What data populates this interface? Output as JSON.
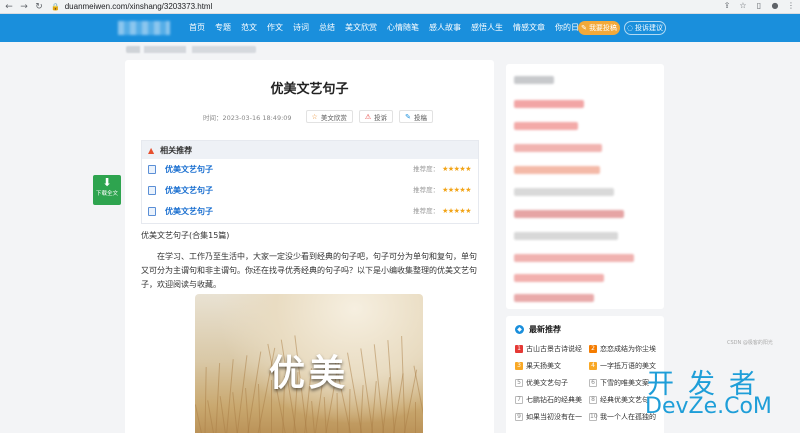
{
  "browser": {
    "url": "duanmeiwen.com/xinshang/3203373.html",
    "back_icon": "arrow-left-icon",
    "forward_icon": "arrow-right-icon",
    "reload_icon": "reload-icon"
  },
  "header": {
    "nav": [
      "首页",
      "专题",
      "范文",
      "作文",
      "诗词",
      "总结",
      "美文欣赏",
      "心情随笔",
      "感人故事",
      "感悟人生",
      "情感文章",
      "你的日志"
    ],
    "submit_label": "我要投稿",
    "feedback_label": "投诉建议",
    "accent": "#1a8fdc"
  },
  "article": {
    "title": "优美文艺句子",
    "time_label": "时间：2023-03-16 18:49:09",
    "category_label": "美文欣赏",
    "report_label": "投诉",
    "submit_label": "投稿",
    "related_title": "相关推荐",
    "related": [
      {
        "title": "优美文艺句子",
        "score_label": "推荐度：",
        "stars": "★★★★★"
      },
      {
        "title": "优美文艺句子",
        "score_label": "推荐度：",
        "stars": "★★★★★"
      },
      {
        "title": "优美文艺句子",
        "score_label": "推荐度：",
        "stars": "★★★★★"
      }
    ],
    "intro": "优美文艺句子(合集15篇)",
    "paragraph": "在学习、工作乃至生活中，大家一定没少看到经典的句子吧，句子可分为单句和复句，单句又可分为主谓句和非主谓句。你还在找寻优秀经典的句子吗？以下是小编收集整理的优美文艺句子，欢迎阅读与收藏。",
    "hero_text": "优美"
  },
  "download": {
    "label": "下载全文"
  },
  "sidebar": {
    "latest_title": "最新推荐",
    "latest": [
      {
        "n": "1",
        "text": "古山古景古诗说经"
      },
      {
        "n": "2",
        "text": "恋恋成结为你尘埃"
      },
      {
        "n": "3",
        "text": "果天扬美文"
      },
      {
        "n": "4",
        "text": "一字抵万语的美文"
      },
      {
        "n": "5",
        "text": "优美文艺句子"
      },
      {
        "n": "6",
        "text": "下雪的唯美文案"
      },
      {
        "n": "7",
        "text": "七鹏钻石的经典美"
      },
      {
        "n": "8",
        "text": "经典优美文艺句"
      },
      {
        "n": "9",
        "text": "如果当初没有在一"
      },
      {
        "n": "10",
        "text": "我一个人在孤独的"
      }
    ]
  },
  "watermark": {
    "top": "开发者",
    "bottom": "DevZe.CoM",
    "csdn": "CSDN @极客的阳光"
  }
}
